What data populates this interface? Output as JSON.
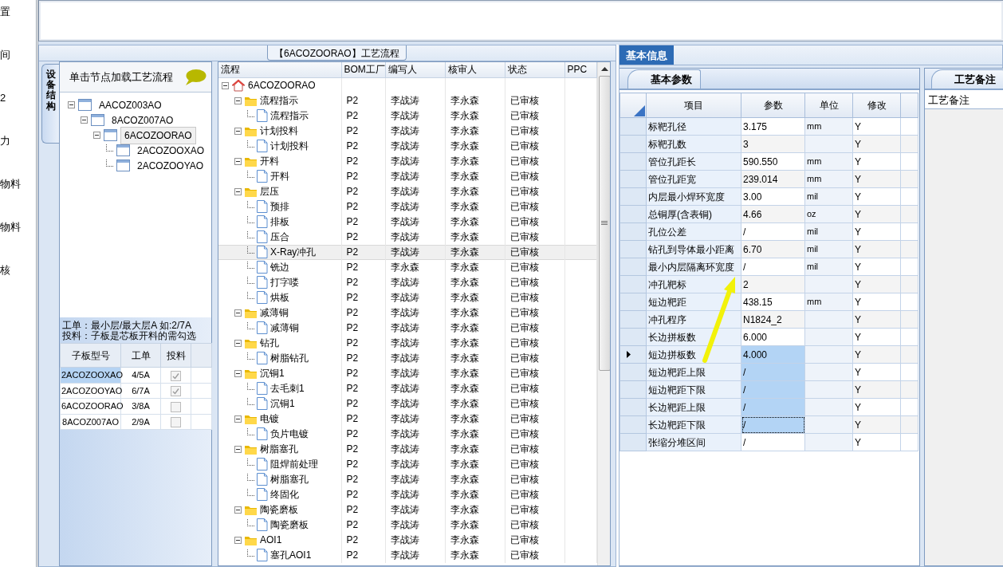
{
  "side_menu": [
    {
      "label": "置"
    },
    {
      "label": "间"
    },
    {
      "label": "2"
    },
    {
      "label": "力"
    },
    {
      "label": "物料"
    },
    {
      "label": "物料"
    },
    {
      "label": "核"
    }
  ],
  "structure": {
    "vertical_tab": "设备结构",
    "header": "单击节点加载工艺流程",
    "tree": [
      {
        "label": "AACOZ003AO",
        "expanded": true,
        "selected": false,
        "children": [
          {
            "label": "8ACOZ007AO",
            "expanded": true,
            "selected": false,
            "children": [
              {
                "label": "6ACOZOORAO",
                "expanded": true,
                "selected": true,
                "children": [
                  {
                    "label": "2ACOZOOXAO",
                    "selected": false
                  },
                  {
                    "label": "2ACOZOOYAO",
                    "selected": false
                  }
                ]
              }
            ]
          }
        ]
      }
    ],
    "notes": [
      "工单：最小层/最大层A 如:2/7A",
      "投料：子板是芯板开料的需勾选"
    ],
    "boards": {
      "columns": [
        "子板型号",
        "工单",
        "投料"
      ],
      "rows": [
        {
          "model": "2ACOZOOXAO",
          "order": "4/5A",
          "checked": true,
          "selected": true
        },
        {
          "model": "2ACOZOOYAO",
          "order": "6/7A",
          "checked": true,
          "selected": false
        },
        {
          "model": "6ACOZOORAO",
          "order": "3/8A",
          "checked": false,
          "selected": false
        },
        {
          "model": "8ACOZ007AO",
          "order": "2/9A",
          "checked": false,
          "selected": false
        }
      ]
    }
  },
  "flow": {
    "title": "【6ACOZOORAO】工艺流程",
    "columns": [
      "流程",
      "BOM工厂",
      "编写人",
      "核审人",
      "状态",
      "PPC"
    ],
    "tree": [
      {
        "kind": "root",
        "label": "6ACOZOORAO",
        "expanded": true,
        "selected": false,
        "children": [
          {
            "kind": "folder",
            "label": "流程指示",
            "bom": "P2",
            "writer": "李战涛",
            "reviewer": "李永森",
            "status": "已审核",
            "expanded": true,
            "selected": false,
            "children": [
              {
                "kind": "step",
                "label": "流程指示",
                "bom": "P2",
                "writer": "李战涛",
                "reviewer": "李永森",
                "status": "已审核",
                "selected": false
              }
            ]
          },
          {
            "kind": "folder",
            "label": "计划投料",
            "bom": "P2",
            "writer": "李战涛",
            "reviewer": "李永森",
            "status": "已审核",
            "expanded": true,
            "selected": false,
            "children": [
              {
                "kind": "step",
                "label": "计划投料",
                "bom": "P2",
                "writer": "李战涛",
                "reviewer": "李永森",
                "status": "已审核",
                "selected": false
              }
            ]
          },
          {
            "kind": "folder",
            "label": "开料",
            "bom": "P2",
            "writer": "李战涛",
            "reviewer": "李永森",
            "status": "已审核",
            "expanded": true,
            "selected": false,
            "children": [
              {
                "kind": "step",
                "label": "开料",
                "bom": "P2",
                "writer": "李战涛",
                "reviewer": "李永森",
                "status": "已审核",
                "selected": false
              }
            ]
          },
          {
            "kind": "folder",
            "label": "层压",
            "bom": "P2",
            "writer": "李战涛",
            "reviewer": "李永森",
            "status": "已审核",
            "expanded": true,
            "selected": false,
            "children": [
              {
                "kind": "step",
                "label": "预排",
                "bom": "P2",
                "writer": "李战涛",
                "reviewer": "李永森",
                "status": "已审核",
                "selected": false
              },
              {
                "kind": "step",
                "label": "排板",
                "bom": "P2",
                "writer": "李战涛",
                "reviewer": "李永森",
                "status": "已审核",
                "selected": false
              },
              {
                "kind": "step",
                "label": "压合",
                "bom": "P2",
                "writer": "李战涛",
                "reviewer": "李永森",
                "status": "已审核",
                "selected": false
              },
              {
                "kind": "step",
                "label": "X-Ray冲孔",
                "bom": "P2",
                "writer": "李战涛",
                "reviewer": "李永森",
                "status": "已审核",
                "selected": true
              },
              {
                "kind": "step",
                "label": "铣边",
                "bom": "P2",
                "writer": "李永森",
                "reviewer": "李永森",
                "status": "已审核",
                "selected": false
              },
              {
                "kind": "step",
                "label": "打字喽",
                "bom": "P2",
                "writer": "李战涛",
                "reviewer": "李永森",
                "status": "已审核",
                "selected": false
              },
              {
                "kind": "step",
                "label": "烘板",
                "bom": "P2",
                "writer": "李战涛",
                "reviewer": "李永森",
                "status": "已审核",
                "selected": false
              }
            ]
          },
          {
            "kind": "folder",
            "label": "减薄铜",
            "bom": "P2",
            "writer": "李战涛",
            "reviewer": "李永森",
            "status": "已审核",
            "expanded": true,
            "selected": false,
            "children": [
              {
                "kind": "step",
                "label": "减薄铜",
                "bom": "P2",
                "writer": "李战涛",
                "reviewer": "李永森",
                "status": "已审核",
                "selected": false
              }
            ]
          },
          {
            "kind": "folder",
            "label": "钻孔",
            "bom": "P2",
            "writer": "李战涛",
            "reviewer": "李永森",
            "status": "已审核",
            "expanded": true,
            "selected": false,
            "children": [
              {
                "kind": "step",
                "label": "树脂钻孔",
                "bom": "P2",
                "writer": "李战涛",
                "reviewer": "李永森",
                "status": "已审核",
                "selected": false
              }
            ]
          },
          {
            "kind": "folder",
            "label": "沉铜1",
            "bom": "P2",
            "writer": "李战涛",
            "reviewer": "李永森",
            "status": "已审核",
            "expanded": true,
            "selected": false,
            "children": [
              {
                "kind": "step",
                "label": "去毛刺1",
                "bom": "P2",
                "writer": "李战涛",
                "reviewer": "李永森",
                "status": "已审核",
                "selected": false
              },
              {
                "kind": "step",
                "label": "沉铜1",
                "bom": "P2",
                "writer": "李战涛",
                "reviewer": "李永森",
                "status": "已审核",
                "selected": false
              }
            ]
          },
          {
            "kind": "folder",
            "label": "电镀",
            "bom": "P2",
            "writer": "李战涛",
            "reviewer": "李永森",
            "status": "已审核",
            "expanded": true,
            "selected": false,
            "children": [
              {
                "kind": "step",
                "label": "负片电镀",
                "bom": "P2",
                "writer": "李战涛",
                "reviewer": "李永森",
                "status": "已审核",
                "selected": false
              }
            ]
          },
          {
            "kind": "folder",
            "label": "树脂塞孔",
            "bom": "P2",
            "writer": "李战涛",
            "reviewer": "李永森",
            "status": "已审核",
            "expanded": true,
            "selected": false,
            "children": [
              {
                "kind": "step",
                "label": "阻焊前处理",
                "bom": "P2",
                "writer": "李战涛",
                "reviewer": "李永森",
                "status": "已审核",
                "selected": false
              },
              {
                "kind": "step",
                "label": "树脂塞孔",
                "bom": "P2",
                "writer": "李战涛",
                "reviewer": "李永森",
                "status": "已审核",
                "selected": false
              },
              {
                "kind": "step",
                "label": "终固化",
                "bom": "P2",
                "writer": "李战涛",
                "reviewer": "李永森",
                "status": "已审核",
                "selected": false
              }
            ]
          },
          {
            "kind": "folder",
            "label": "陶瓷磨板",
            "bom": "P2",
            "writer": "李战涛",
            "reviewer": "李永森",
            "status": "已审核",
            "expanded": true,
            "selected": false,
            "children": [
              {
                "kind": "step",
                "label": "陶瓷磨板",
                "bom": "P2",
                "writer": "李战涛",
                "reviewer": "李永森",
                "status": "已审核",
                "selected": false
              }
            ]
          },
          {
            "kind": "folder",
            "label": "AOI1",
            "bom": "P2",
            "writer": "李战涛",
            "reviewer": "李永森",
            "status": "已审核",
            "expanded": true,
            "selected": false,
            "children": [
              {
                "kind": "step",
                "label": "塞孔AOI1",
                "bom": "P2",
                "writer": "李战涛",
                "reviewer": "李永森",
                "status": "已审核",
                "selected": false
              }
            ]
          }
        ]
      }
    ]
  },
  "info": {
    "tabs": [
      {
        "label": "基本信息",
        "selected": true
      }
    ],
    "sub_tab": "基本参数",
    "columns": [
      "项目",
      "参数",
      "单位",
      "修改"
    ],
    "rows": [
      {
        "item": "标靶孔径",
        "value": "3.175",
        "unit": "mm",
        "modify": "Y",
        "current": false,
        "selected": false,
        "focused": false
      },
      {
        "item": "标靶孔数",
        "value": "3",
        "modify": "Y",
        "current": false,
        "selected": false,
        "focused": false
      },
      {
        "item": "管位孔距长",
        "value": "590.550",
        "unit": "mm",
        "modify": "Y",
        "current": false,
        "selected": false,
        "focused": false
      },
      {
        "item": "管位孔距宽",
        "value": "239.014",
        "unit": "mm",
        "modify": "Y",
        "current": false,
        "selected": false,
        "focused": false
      },
      {
        "item": "内层最小焊环宽度",
        "value": "3.00",
        "unit": "mil",
        "modify": "Y",
        "current": false,
        "selected": false,
        "focused": false
      },
      {
        "item": "总铜厚(含表铜)",
        "value": "4.66",
        "unit": "oz",
        "modify": "Y",
        "current": false,
        "selected": false,
        "focused": false
      },
      {
        "item": "孔位公差",
        "value": "/",
        "unit": "mil",
        "modify": "Y",
        "current": false,
        "selected": false,
        "focused": false
      },
      {
        "item": "钻孔到导体最小距离",
        "value": "6.70",
        "unit": "mil",
        "modify": "Y",
        "current": false,
        "selected": false,
        "focused": false
      },
      {
        "item": "最小内层隔离环宽度",
        "value": "/",
        "unit": "mil",
        "modify": "Y",
        "current": false,
        "selected": false,
        "focused": false
      },
      {
        "item": "冲孔靶标",
        "value": "2",
        "modify": "Y",
        "current": false,
        "selected": false,
        "focused": false
      },
      {
        "item": "短边靶距",
        "value": "438.15",
        "unit": "mm",
        "modify": "Y",
        "current": false,
        "selected": false,
        "focused": false
      },
      {
        "item": "冲孔程序",
        "value": "N1824_2",
        "modify": "Y",
        "current": false,
        "selected": false,
        "focused": false
      },
      {
        "item": "长边拼板数",
        "value": "6.000",
        "modify": "Y",
        "current": false,
        "selected": false,
        "focused": false
      },
      {
        "item": "短边拼板数",
        "value": "4.000",
        "modify": "Y",
        "current": true,
        "selected": true,
        "focused": false
      },
      {
        "item": "短边靶距上限",
        "value": "/",
        "modify": "Y",
        "current": false,
        "selected": true,
        "focused": false
      },
      {
        "item": "短边靶距下限",
        "value": "/",
        "modify": "Y",
        "current": false,
        "selected": true,
        "focused": false
      },
      {
        "item": "长边靶距上限",
        "value": "/",
        "modify": "Y",
        "current": false,
        "selected": true,
        "focused": false
      },
      {
        "item": "长边靶距下限",
        "value": "/",
        "modify": "Y",
        "current": false,
        "selected": true,
        "focused": true
      },
      {
        "item": "张缩分堆区间",
        "value": "/",
        "modify": "Y",
        "current": false,
        "selected": false,
        "focused": false
      }
    ]
  },
  "remarks": {
    "tab": "工艺备注",
    "label": "工艺备注"
  }
}
